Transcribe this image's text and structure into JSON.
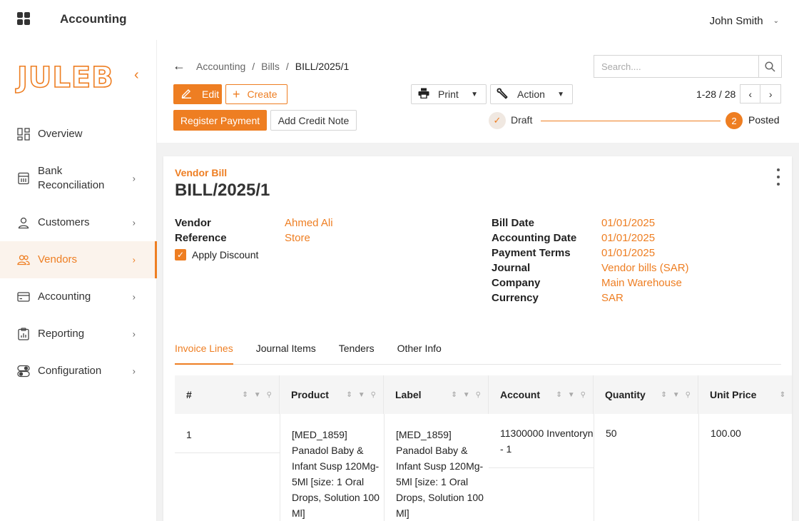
{
  "topbar": {
    "app_title": "Accounting",
    "user_name": "John Smith",
    "user_chevron_icon": "chevron-down-icon",
    "apps_icon": "grid-icon"
  },
  "sidebar": {
    "logo_text": "JULEB",
    "collapse_icon": "chevron-left-icon",
    "items": [
      {
        "label": "Overview",
        "icon": "dashboard-icon",
        "has_children": false
      },
      {
        "label": "Bank Reconciliation",
        "icon": "bank-icon",
        "has_children": true
      },
      {
        "label": "Customers",
        "icon": "user-icon",
        "has_children": true
      },
      {
        "label": "Vendors",
        "icon": "users-icon",
        "has_children": true,
        "active": true
      },
      {
        "label": "Accounting",
        "icon": "card-icon",
        "has_children": true
      },
      {
        "label": "Reporting",
        "icon": "clipboard-chart-icon",
        "has_children": true
      },
      {
        "label": "Configuration",
        "icon": "toggle-icon",
        "has_children": true
      }
    ]
  },
  "breadcrumb": {
    "items": [
      "Accounting",
      "Bills",
      "BILL/2025/1"
    ],
    "separator": "/"
  },
  "search": {
    "placeholder": "Search...."
  },
  "toolbar": {
    "edit_label": "Edit",
    "create_label": "Create",
    "register_payment_label": "Register Payment",
    "add_credit_note_label": "Add Credit Note",
    "print_label": "Print",
    "action_label": "Action"
  },
  "pager": {
    "text": "1-28 / 28"
  },
  "status": {
    "draft_label": "Draft",
    "posted_label": "Posted",
    "posted_step": "2"
  },
  "bill": {
    "type": "Vendor Bill",
    "name": "BILL/2025/1",
    "left_fields": [
      {
        "label": "Vendor",
        "value": "Ahmed Ali"
      },
      {
        "label": "Reference",
        "value": "Store"
      }
    ],
    "apply_discount_label": "Apply Discount",
    "apply_discount_checked": true,
    "right_fields": [
      {
        "label": "Bill Date",
        "value": "01/01/2025"
      },
      {
        "label": "Accounting Date",
        "value": "01/01/2025"
      },
      {
        "label": "Payment Terms",
        "value": "01/01/2025"
      },
      {
        "label": "Journal",
        "value": "Vendor bills (SAR)"
      },
      {
        "label": "Company",
        "value": "Main Warehouse"
      },
      {
        "label": "Currency",
        "value": "SAR"
      }
    ]
  },
  "tabs": [
    {
      "label": "Invoice Lines",
      "active": true
    },
    {
      "label": "Journal Items"
    },
    {
      "label": "Tenders"
    },
    {
      "label": "Other Info"
    }
  ],
  "grid": {
    "columns": [
      "#",
      "Product",
      "Label",
      "Account",
      "Quantity",
      "Unit Price"
    ],
    "rows": [
      {
        "num": "1",
        "product": "[MED_1859] Panadol Baby & Infant Susp 120Mg-5Ml [size: 1 Oral Drops, Solution 100 Ml]",
        "label": "[MED_1859] Panadol Baby & Infant Susp 120Mg-5Ml [size: 1 Oral Drops, Solution 100 Ml]",
        "account": "11300000 Inventoryn - 1",
        "quantity": "50",
        "unit_price": "100.00"
      }
    ]
  },
  "colors": {
    "accent": "#ee7e22",
    "text": "#222222",
    "muted": "#666666",
    "background": "#f2f2f2"
  }
}
